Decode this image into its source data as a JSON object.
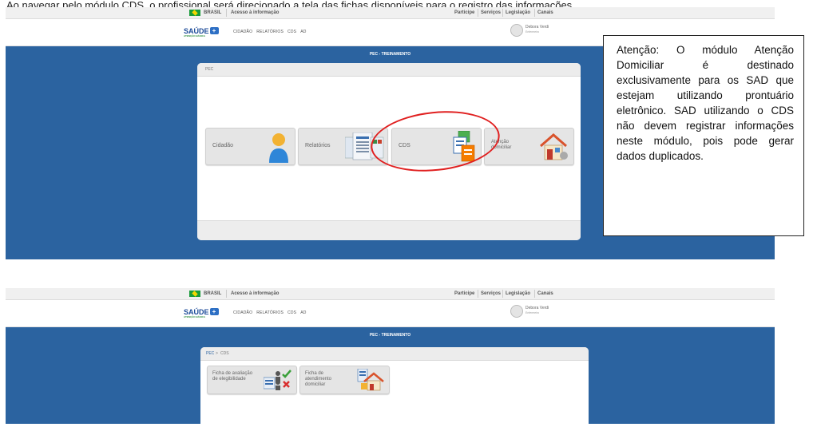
{
  "caption": "Ao navegar pelo módulo CDS, o profissional será direcionado a tela das fichas disponíveis para o registro das informações.",
  "gov_bar": {
    "brasil": "BRASIL",
    "acesso": "Acesso à informação",
    "links": [
      "Participe",
      "Serviços",
      "Legislação",
      "Canais"
    ]
  },
  "header": {
    "logo_text": "SAÚDE",
    "logo_sub": "ATENÇÃO BÁSICA",
    "nav": [
      "CIDADÃO",
      "RELATÓRIOS",
      "CDS",
      "AD"
    ],
    "user_name": "Debora Verdi",
    "user_role": "Enfermeiro"
  },
  "screen1": {
    "title": "PEC - TREINAMENTO",
    "breadcrumb": "PEC",
    "tiles": [
      {
        "label": "Cidadão",
        "icon": "citizen-icon"
      },
      {
        "label": "Relatórios",
        "icon": "reports-icon"
      },
      {
        "label": "CDS",
        "icon": "cds-forms-icon"
      },
      {
        "label": "Atenção domiciliar",
        "icon": "home-care-icon"
      }
    ]
  },
  "note": {
    "text": "Atenção: O módulo Atenção Domiciliar é destinado exclusivamente para os SAD que estejam utilizando prontuário eletrônico. SAD utilizando o CDS não devem registrar informações neste módulo, pois pode gerar dados duplicados."
  },
  "screen2": {
    "title": "PEC - TREINAMENTO",
    "breadcrumb_link": "PEC",
    "breadcrumb_sep": ">",
    "breadcrumb_current": "CDS",
    "tiles": [
      {
        "label": "Ficha de avaliação de elegibilidade",
        "icon": "eligibility-form-icon"
      },
      {
        "label": "Ficha de atendimento domiciliar",
        "icon": "home-visit-form-icon"
      }
    ]
  },
  "colors": {
    "band": "#2b63a0",
    "highlight_circle": "#e02020",
    "accent": "#1b4a98"
  }
}
